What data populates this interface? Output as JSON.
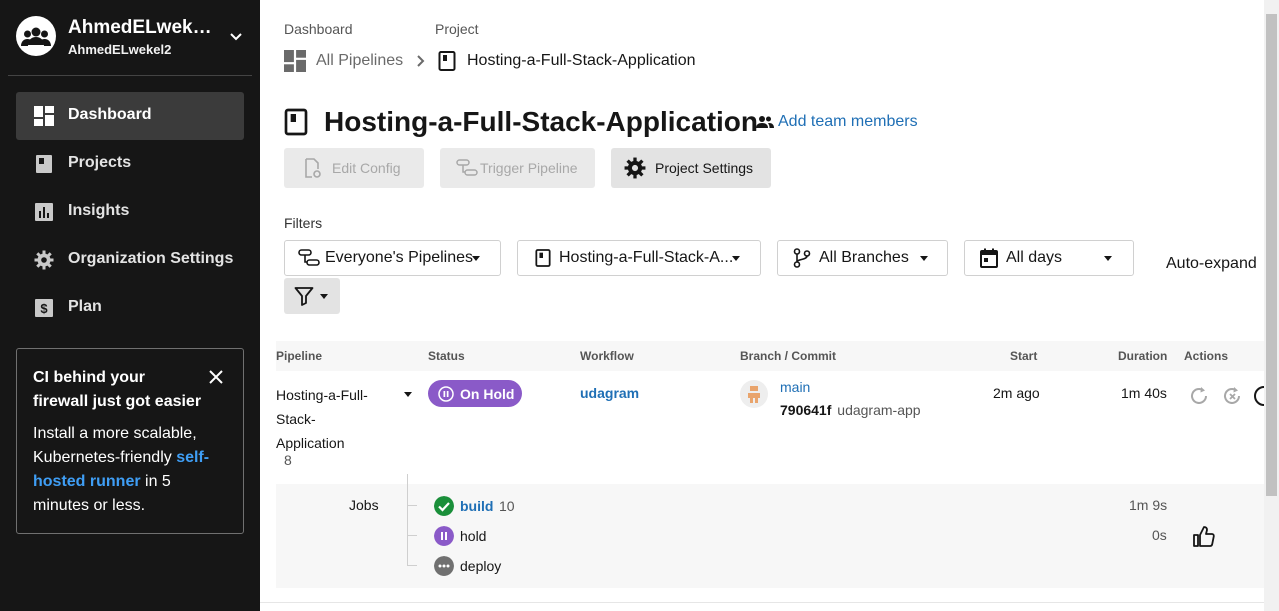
{
  "sidebar": {
    "org_name": "AhmedELwekel2",
    "org_sub": "AhmedELwekel2",
    "items": [
      {
        "label": "Dashboard"
      },
      {
        "label": "Projects"
      },
      {
        "label": "Insights"
      },
      {
        "label": "Organization Settings"
      },
      {
        "label": "Plan"
      }
    ],
    "promo": {
      "title": "CI behind your firewall just got easier",
      "body_start": "Install a more scalable, Kubernetes-friendly ",
      "link": "self-hosted runner",
      "body_end": " in 5 minutes or less."
    }
  },
  "breadcrumb": {
    "top_dashboard": "Dashboard",
    "top_project": "Project",
    "all_pipelines": "All Pipelines",
    "project": "Hosting-a-Full-Stack-Application"
  },
  "page": {
    "title": "Hosting-a-Full-Stack-Application",
    "add_team": "Add team members"
  },
  "buttons": {
    "edit_config": "Edit Config",
    "trigger_pipeline": "Trigger Pipeline",
    "project_settings": "Project Settings"
  },
  "filters": {
    "label": "Filters",
    "pipelines": "Everyone's Pipelines",
    "project": "Hosting-a-Full-Stack-A...",
    "branches": "All Branches",
    "days": "All days",
    "auto_expand": "Auto-expand"
  },
  "table": {
    "headers": [
      "Pipeline",
      "Status",
      "Workflow",
      "Branch / Commit",
      "Start",
      "Duration",
      "Actions"
    ],
    "row": {
      "pipeline_line1": "Hosting-a-Full-",
      "pipeline_line2": "Stack-",
      "pipeline_line3": "Application",
      "pipeline_number": "8",
      "status": "On Hold",
      "workflow": "udagram",
      "branch": "main",
      "commit": "790641f",
      "commit_msg": "udagram-app",
      "start": "2m ago",
      "duration": "1m 40s"
    },
    "jobs_label": "Jobs",
    "jobs": [
      {
        "name": "build",
        "number": "10",
        "duration": "1m 9s",
        "status": "success"
      },
      {
        "name": "hold",
        "number": "",
        "duration": "0s",
        "status": "on-hold"
      },
      {
        "name": "deploy",
        "number": "",
        "duration": "",
        "status": "queued"
      }
    ]
  },
  "colors": {
    "sidebar_bg": "#161616",
    "link": "#1f6fb5",
    "on_hold": "#8a5ac8",
    "success": "#1a8f3a",
    "queued": "#707070"
  }
}
